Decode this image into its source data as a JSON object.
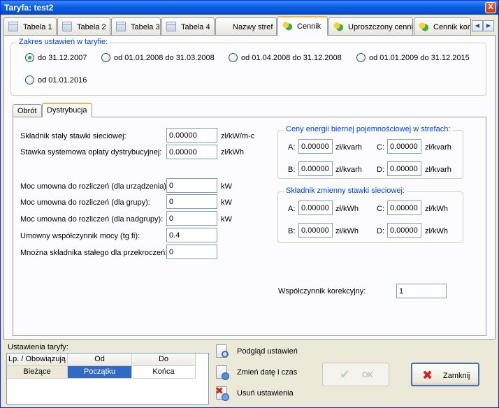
{
  "window": {
    "title": "Taryfa: test2",
    "close_glyph": "X"
  },
  "top_tabs": [
    {
      "label": "Tabela 1",
      "icon": "table-icon"
    },
    {
      "label": "Tabela 2",
      "icon": "table-icon"
    },
    {
      "label": "Tabela 3",
      "icon": "table-icon"
    },
    {
      "label": "Tabela 4",
      "icon": "table-icon"
    },
    {
      "label": "Nazwy stref",
      "icon": ""
    },
    {
      "label": "Cennik",
      "icon": "tariff-icon",
      "active": true
    },
    {
      "label": "Uproszczony cennik",
      "icon": "tariff-icon"
    },
    {
      "label": "Cennik komu",
      "icon": "tariff-icon"
    }
  ],
  "tab_scroll": {
    "left": "◀",
    "right": "▶"
  },
  "range": {
    "legend": "Zakres ustawień w taryfie:",
    "options": [
      {
        "label": "do 31.12.2007",
        "checked": true
      },
      {
        "label": "od 01.01.2008 do 31.03.2008",
        "checked": false
      },
      {
        "label": "od 01.04.2008 do 31.12.2008",
        "checked": false
      },
      {
        "label": "od 01.01.2009 do 31.12.2015",
        "checked": false
      },
      {
        "label": "od 01.01.2016",
        "checked": false
      }
    ]
  },
  "inner_tabs": [
    {
      "label": "Obrót",
      "active": false
    },
    {
      "label": "Dystrybucja",
      "active": true
    }
  ],
  "fields": {
    "skladnik_staly": {
      "label": "Składnik stały stawki sieciowej:",
      "value": "0.00000",
      "unit": "zł/kW/m-c"
    },
    "stawka_systemowa": {
      "label": "Stawka systemowa opłaty dystrybucyjnej:",
      "value": "0.00000",
      "unit": "zł/kWh"
    },
    "moc_urzadzenia": {
      "label": "Moc umowna do rozliczeń (dla urządzenia):",
      "value": "0",
      "unit": "kW"
    },
    "moc_grupy": {
      "label": "Moc umowna do rozliczeń (dla grupy):",
      "value": "0",
      "unit": "kW"
    },
    "moc_nadgrupy": {
      "label": "Moc umowna do rozliczeń (dla nadgrupy):",
      "value": "0",
      "unit": "kW"
    },
    "wspolczynnik_mocy": {
      "label": "Umowny współczynnik mocy (tg fi):",
      "value": "0.4"
    },
    "mnozna": {
      "label": "Mnożna składnika stałego dla przekroczeń:",
      "value": "0"
    },
    "korekcyjny": {
      "label": "Współczynnik korekcyjny:",
      "value": "1"
    }
  },
  "ceny_energii": {
    "legend": "Ceny energii biernej pojemnościowej w strefach:",
    "A": {
      "label": "A:",
      "value": "0.00000",
      "unit": "zł/kvarh"
    },
    "B": {
      "label": "B:",
      "value": "0.00000",
      "unit": "zł/kvarh"
    },
    "C": {
      "label": "C:",
      "value": "0.00000",
      "unit": "zł/kvarh"
    },
    "D": {
      "label": "D:",
      "value": "0.00000",
      "unit": "zł/kvarh"
    }
  },
  "skladnik_zmienny": {
    "legend": "Składnik zmienny stawki sieciowej:",
    "A": {
      "label": "A:",
      "value": "0.00000",
      "unit": "zł/kWh"
    },
    "B": {
      "label": "B:",
      "value": "0.00000",
      "unit": "zł/kWh"
    },
    "C": {
      "label": "C:",
      "value": "0.00000",
      "unit": "zł/kWh"
    },
    "D": {
      "label": "D:",
      "value": "0.00000",
      "unit": "zł/kWh"
    }
  },
  "settings": {
    "label": "Ustawienia taryfy:",
    "columns": [
      "Lp. / Obowiązują",
      "Od",
      "Do"
    ],
    "rows": [
      [
        "Bieżące",
        "Początku",
        "Końca"
      ]
    ]
  },
  "actions": {
    "preview": "Podgląd ustawień",
    "change_date": "Zmień datę i czas",
    "delete": "Usuń ustawienia"
  },
  "buttons": {
    "ok": "OK",
    "ok_glyph": "✔",
    "close": "Zamknij",
    "close_glyph": "✖"
  },
  "colors": {
    "accent": "#0046d5",
    "selection": "#316ac5",
    "title_bar": "#0a5de0"
  }
}
